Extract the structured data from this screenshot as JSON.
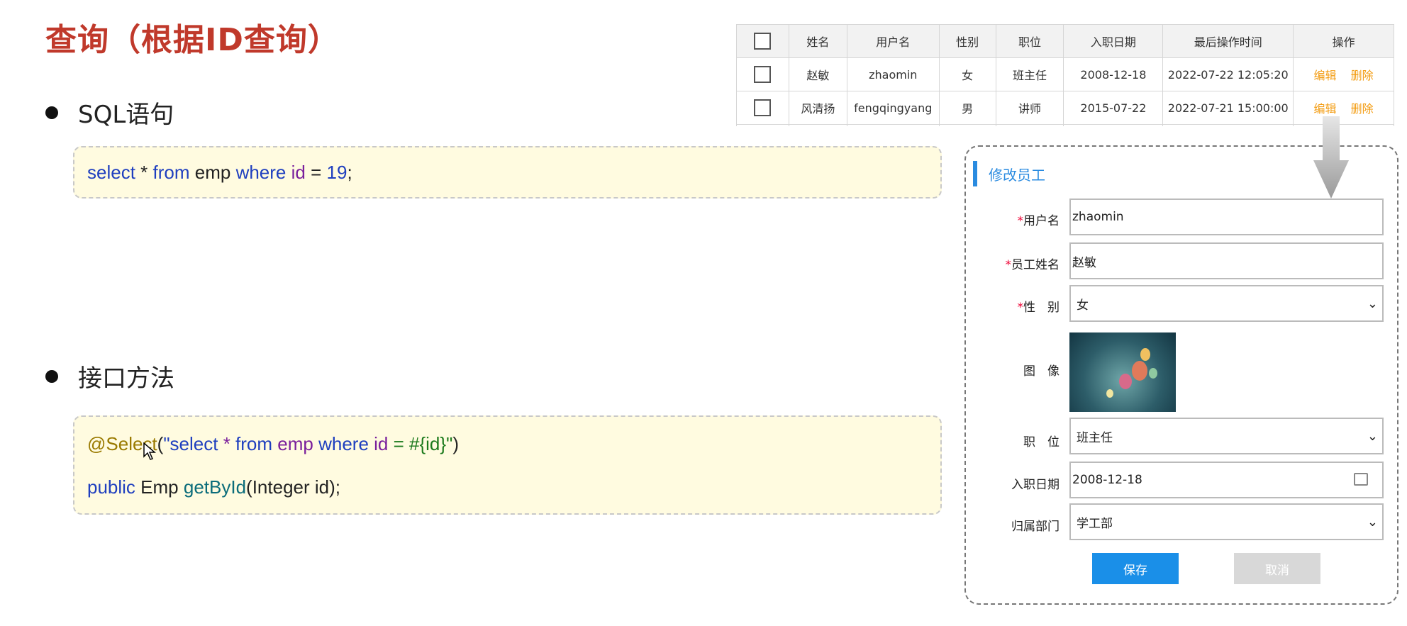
{
  "title": "查询（根据ID查询）",
  "section1": {
    "label": "SQL语句"
  },
  "sql": {
    "select": "select",
    "star": "*",
    "from": "from",
    "table": "emp",
    "where": "where",
    "col": "id",
    "eq": "=",
    "num": "19",
    "semi": ";"
  },
  "section2": {
    "label": "接口方法"
  },
  "iface": {
    "annotation": "@Select",
    "open": "(",
    "q1": "\"select ",
    "star": "*",
    "from": " from ",
    "table": "emp",
    "where": " where ",
    "col": "id",
    "eq": " = ",
    "param": "#{id}",
    "q2": "\"",
    "close": ")",
    "public": "public",
    "type": "Emp",
    "method": "getById",
    "args": "(Integer id);"
  },
  "table": {
    "headers": [
      "姓名",
      "用户名",
      "性别",
      "职位",
      "入职日期",
      "最后操作时间",
      "操作"
    ],
    "rows": [
      {
        "name": "赵敏",
        "username": "zhaomin",
        "gender": "女",
        "job": "班主任",
        "entry": "2008-12-18",
        "updated": "2022-07-22 12:05:20"
      },
      {
        "name": "风清扬",
        "username": "fengqingyang",
        "gender": "男",
        "job": "讲师",
        "entry": "2015-07-22",
        "updated": "2022-07-21 15:00:00"
      }
    ],
    "edit": "编辑",
    "delete": "删除"
  },
  "dialog": {
    "title": "修改员工",
    "username_label": "用户名",
    "username_value": "zhaomin",
    "name_label": "员工姓名",
    "name_value": "赵敏",
    "gender_label": "性　别",
    "gender_value": "女",
    "image_label": "图　像",
    "job_label": "职　位",
    "job_value": "班主任",
    "entry_label": "入职日期",
    "entry_value": "2008-12-18",
    "dept_label": "归属部门",
    "dept_value": "学工部",
    "required_mark": "*",
    "save": "保存",
    "cancel": "取消"
  },
  "colors": {
    "title": "#c0392b",
    "accent": "#1a8fe8",
    "link": "#f39c12",
    "codebg": "#fffbe0"
  }
}
